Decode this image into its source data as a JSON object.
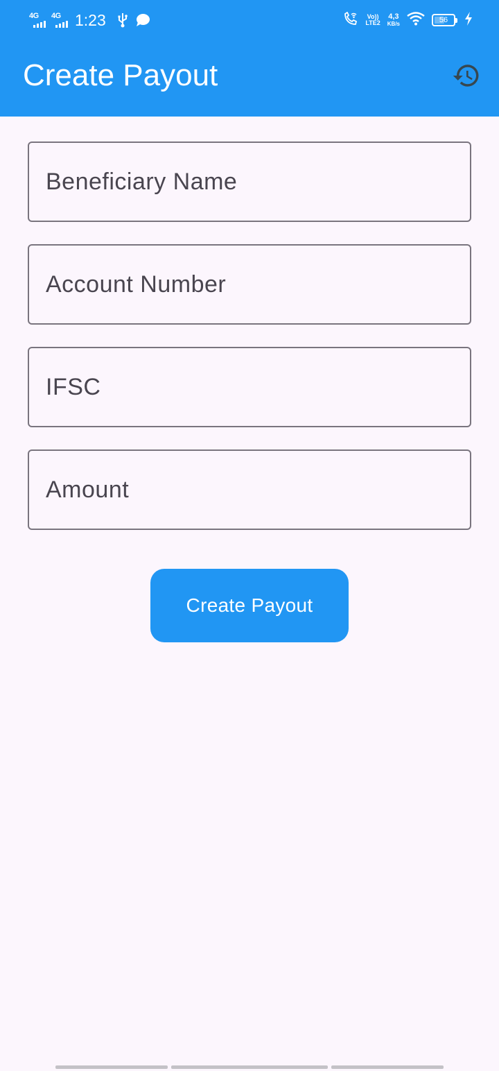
{
  "status_bar": {
    "signal_1_label": "4G",
    "signal_2_label": "4G",
    "time": "1:23",
    "volte_top": "Vo))",
    "volte_bottom": "LTE2",
    "speed_value": "4,3",
    "speed_unit": "KB/s",
    "battery_level": "56",
    "icons": [
      "usb-icon",
      "message-bubble-icon",
      "wifi-calling-icon",
      "wifi-icon",
      "battery-icon",
      "charging-bolt-icon"
    ]
  },
  "app_bar": {
    "title": "Create Payout",
    "action_icon": "history-icon"
  },
  "form": {
    "beneficiary_name_placeholder": "Beneficiary Name",
    "account_number_placeholder": "Account Number",
    "ifsc_placeholder": "IFSC",
    "amount_placeholder": "Amount",
    "submit_label": "Create Payout"
  },
  "colors": {
    "primary": "#2196f3",
    "background": "#fcf6fd",
    "outline": "#79747e",
    "hint_text": "#49454f"
  }
}
